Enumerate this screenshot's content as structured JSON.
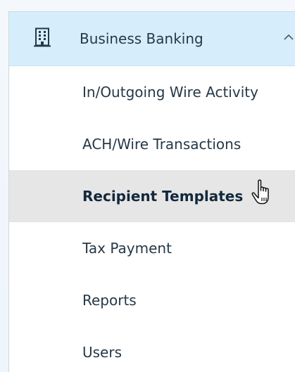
{
  "menu": {
    "header": {
      "icon": "building-icon",
      "label": "Business Banking",
      "chevron_icon": "chevron-up-icon"
    },
    "items": [
      {
        "label": "In/Outgoing Wire Activity",
        "selected": false
      },
      {
        "label": "ACH/Wire Transactions",
        "selected": false
      },
      {
        "label": "Recipient Templates",
        "selected": true
      },
      {
        "label": "Tax Payment",
        "selected": false
      },
      {
        "label": "Reports",
        "selected": false
      },
      {
        "label": "Users",
        "selected": false
      }
    ],
    "cursor_icon": "hand-pointer-icon"
  },
  "colors": {
    "header_background": "#d6eefb",
    "selected_background": "#e6e6e6",
    "text": "#263847",
    "page_background": "#eef5fb"
  }
}
